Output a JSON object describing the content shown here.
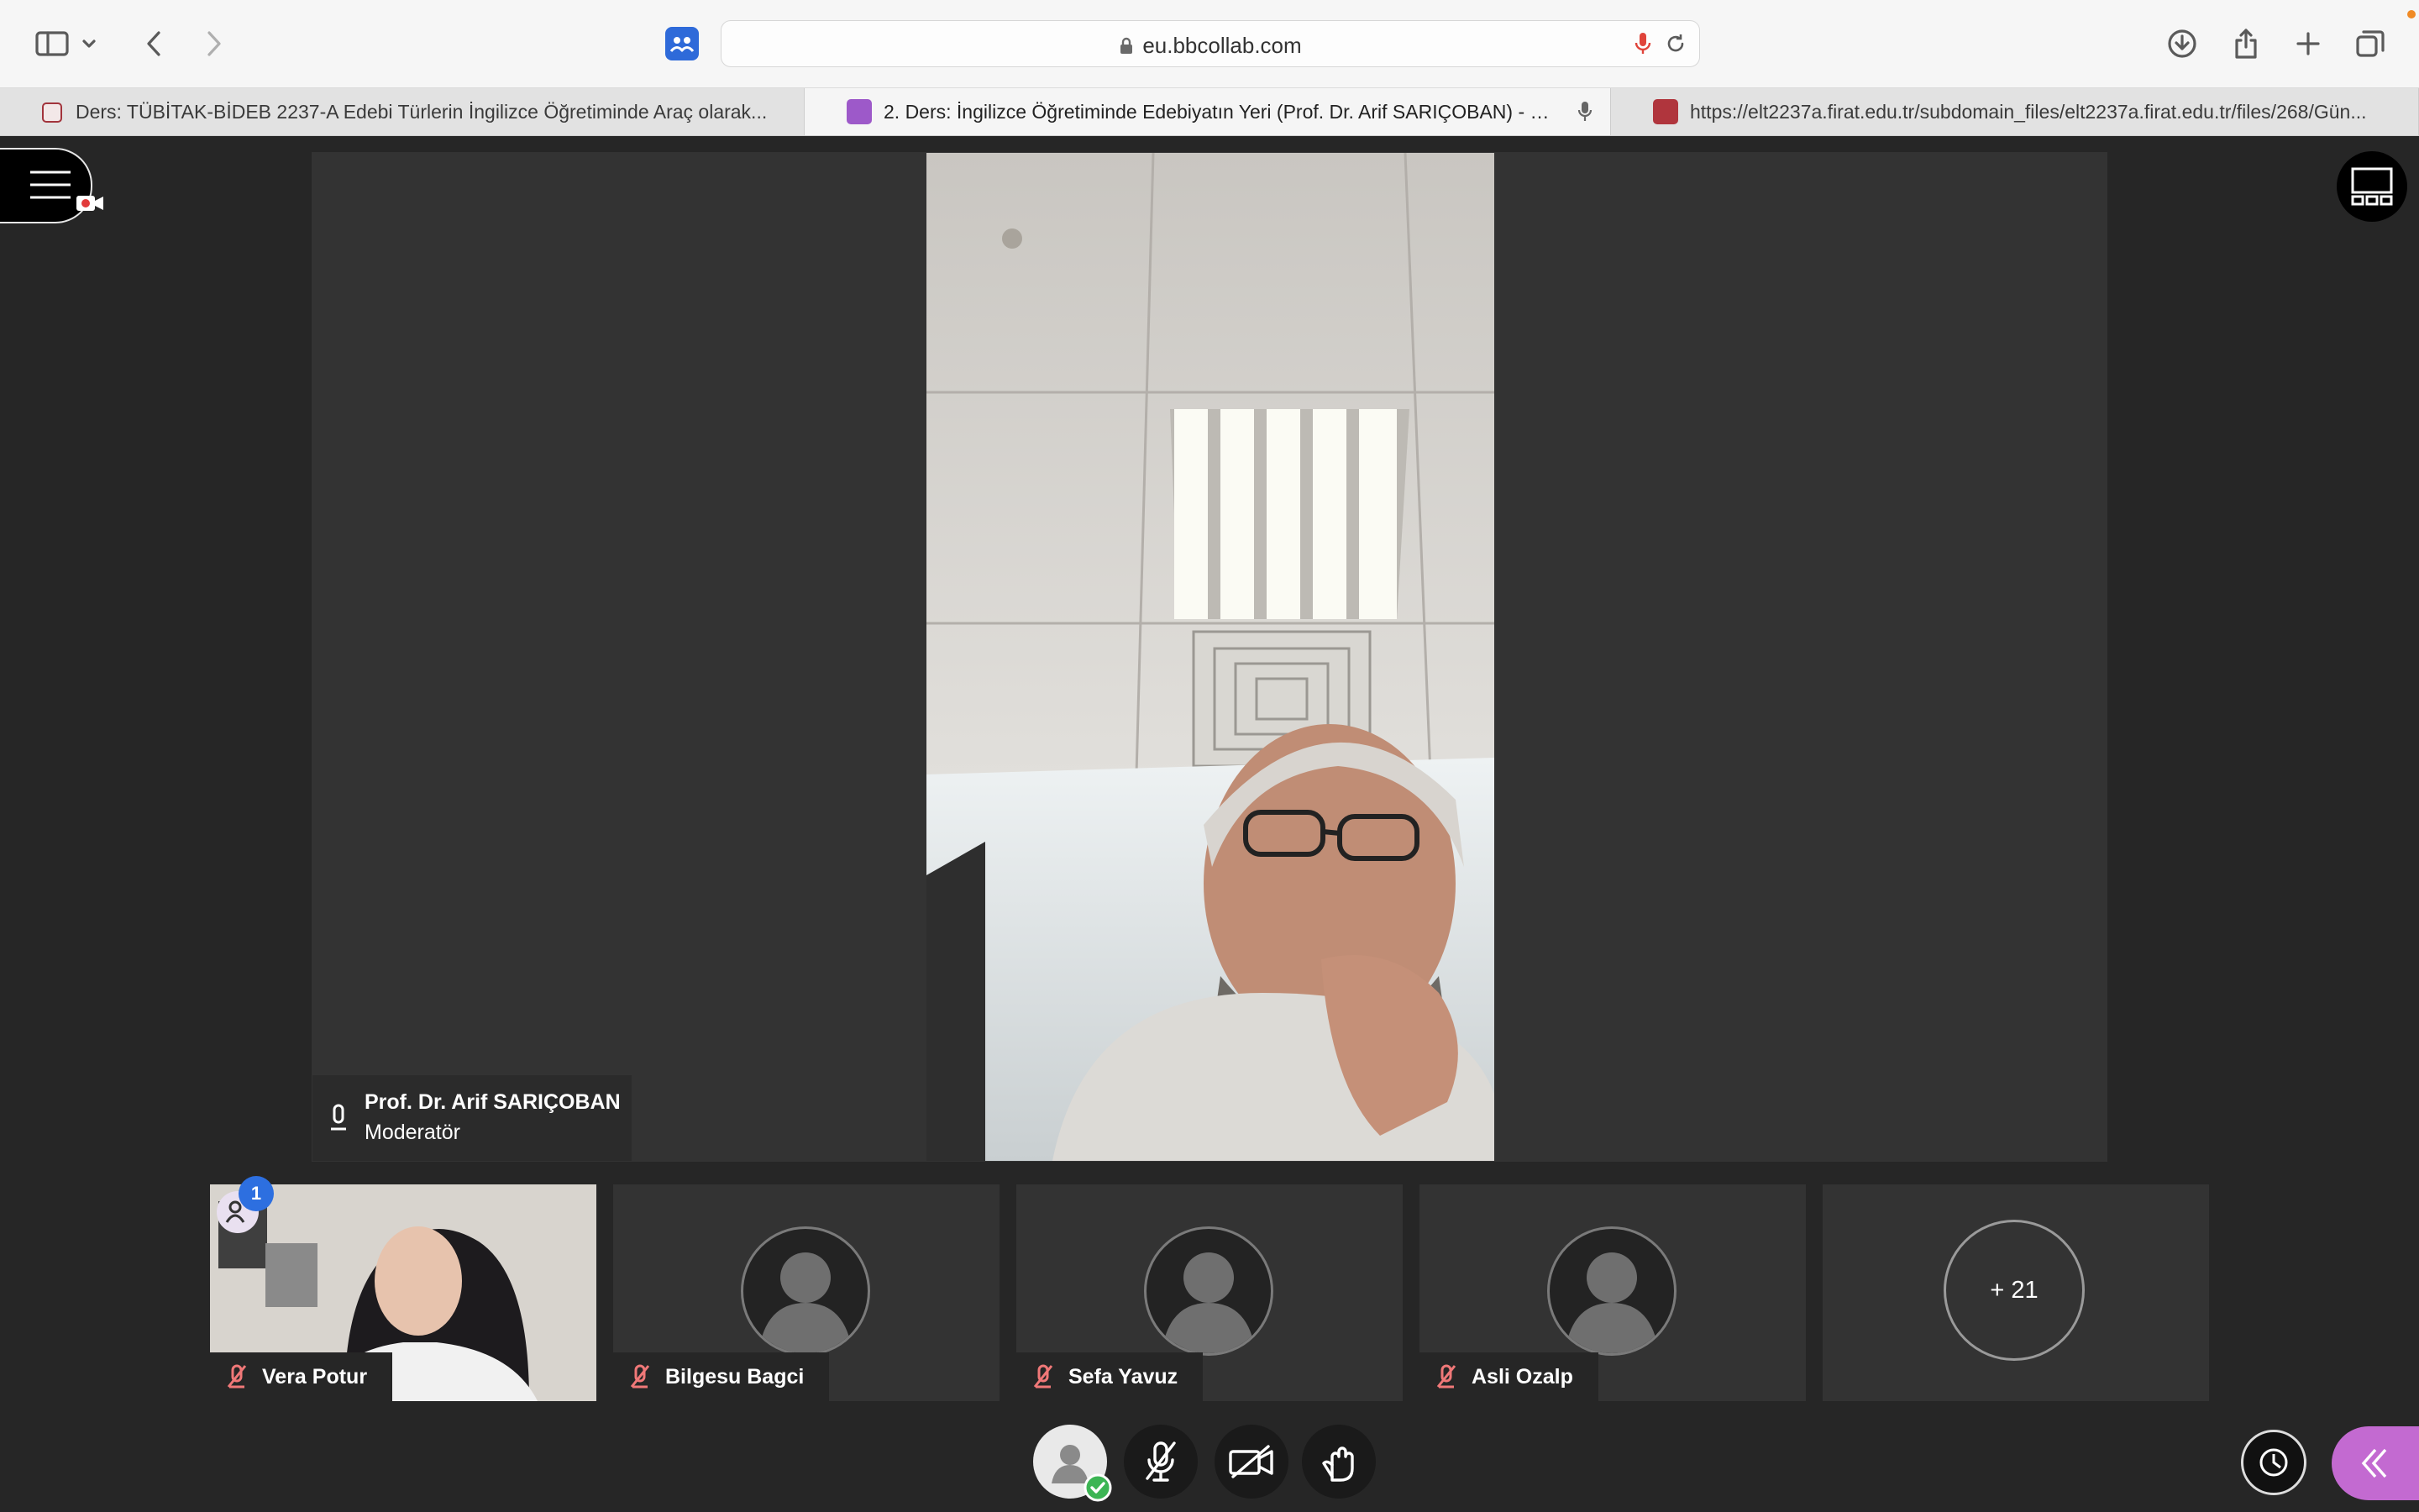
{
  "browser": {
    "url": "eu.bbcollab.com",
    "tabs": [
      {
        "title": "Ders: TÜBİTAK-BİDEB 2237-A Edebi Türlerin İngilizce Öğretiminde Araç olarak..."
      },
      {
        "title": "2. Ders: İngilizce Öğretiminde Edebiyatın Yeri (Prof. Dr. Arif SARIÇOBAN) - Cla..."
      },
      {
        "title": "https://elt2237a.firat.edu.tr/subdomain_files/elt2237a.firat.edu.tr/files/268/Gün..."
      }
    ],
    "icons": {
      "sidebar": "sidebar-icon",
      "back": "chevron-left-icon",
      "forward": "chevron-right-icon",
      "download": "download-icon",
      "share": "share-icon",
      "new_tab": "plus-icon",
      "tab_overview": "tabs-icon",
      "lock": "lock-icon",
      "mic": "microphone-icon",
      "reload": "reload-icon"
    }
  },
  "session": {
    "speaker": {
      "name": "Prof. Dr. Arif SARIÇOBAN",
      "role": "Moderatör"
    },
    "participants": [
      {
        "name": "Vera Potur",
        "muted": true,
        "has_video": true
      },
      {
        "name": "Bilgesu Bagci",
        "muted": true,
        "has_video": false
      },
      {
        "name": "Sefa Yavuz",
        "muted": true,
        "has_video": false
      },
      {
        "name": "Asli Ozalp",
        "muted": true,
        "has_video": false
      }
    ],
    "more_count": "+ 21",
    "raised_hands_badge": "1"
  },
  "colors": {
    "stage_bg": "#262626",
    "tile_bg": "#333333",
    "accent_purple": "#c36ad1",
    "badge_blue": "#2d6fe0",
    "muted_red": "#f07878",
    "status_green": "#3cb554"
  }
}
